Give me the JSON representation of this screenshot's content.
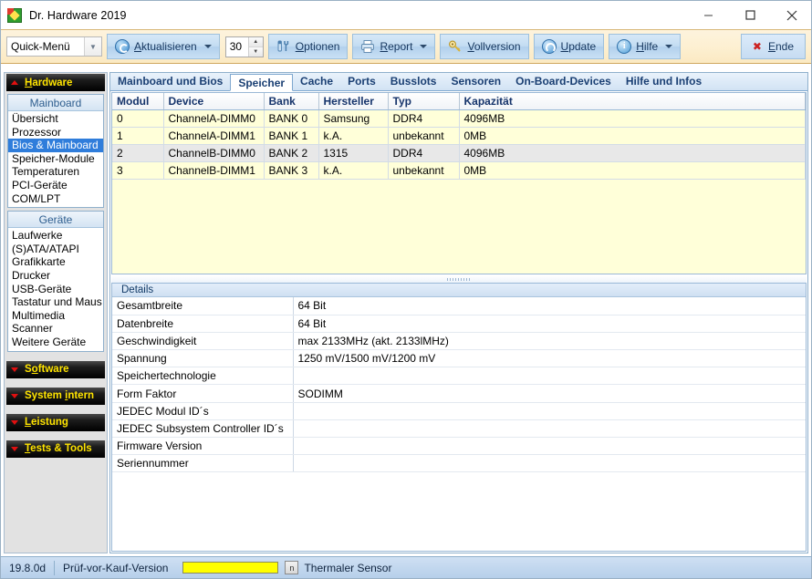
{
  "window": {
    "title": "Dr. Hardware 2019",
    "app_icon": "diamond-logo-icon",
    "controls": {
      "minimize": "minimize-icon",
      "maximize": "maximize-icon",
      "close": "close-icon"
    }
  },
  "toolbar": {
    "quick_menu": {
      "value": "Quick-Menü",
      "arrow": "chevron-down-icon"
    },
    "refresh": {
      "label": "Aktualisieren",
      "accel": "A",
      "icon": "refresh-icon",
      "has_dropdown": true
    },
    "interval": {
      "value": "30"
    },
    "options": {
      "label": "Optionen",
      "accel": "O",
      "icon": "tools-icon"
    },
    "report": {
      "label": "Report",
      "accel": "R",
      "icon": "printer-icon",
      "has_dropdown": true
    },
    "fullversion": {
      "label": "Vollversion",
      "accel": "V",
      "icon": "key-icon"
    },
    "update": {
      "label": "Update",
      "accel": "U",
      "icon": "update-icon"
    },
    "help": {
      "label": "Hilfe",
      "accel": "H",
      "icon": "info-icon",
      "has_dropdown": true
    },
    "end": {
      "label": "Ende",
      "accel": "E",
      "icon": "red-x-icon"
    }
  },
  "sidebar": {
    "groups": [
      {
        "header": "Hardware",
        "accel": "H",
        "expanded": true,
        "arrow": "triangle-up-icon",
        "panels": [
          {
            "title": "Mainboard",
            "items": [
              {
                "label": "Übersicht",
                "selected": false
              },
              {
                "label": "Prozessor",
                "selected": false
              },
              {
                "label": "Bios & Mainboard",
                "selected": true
              },
              {
                "label": "Speicher-Module",
                "selected": false
              },
              {
                "label": "Temperaturen",
                "selected": false
              },
              {
                "label": "PCI-Geräte",
                "selected": false
              },
              {
                "label": "COM/LPT",
                "selected": false
              }
            ]
          },
          {
            "title": "Geräte",
            "items": [
              {
                "label": "Laufwerke",
                "selected": false
              },
              {
                "label": "(S)ATA/ATAPI",
                "selected": false
              },
              {
                "label": "Grafikkarte",
                "selected": false
              },
              {
                "label": "Drucker",
                "selected": false
              },
              {
                "label": "USB-Geräte",
                "selected": false
              },
              {
                "label": "Tastatur und Maus",
                "selected": false
              },
              {
                "label": "Multimedia",
                "selected": false
              },
              {
                "label": "Scanner",
                "selected": false
              },
              {
                "label": "Weitere Geräte",
                "selected": false
              }
            ]
          }
        ]
      },
      {
        "header": "Software",
        "accel": "o",
        "expanded": false,
        "arrow": "triangle-down-icon",
        "panels": []
      },
      {
        "header": "System intern",
        "accel": "i",
        "expanded": false,
        "arrow": "triangle-down-icon",
        "panels": []
      },
      {
        "header": "Leistung",
        "accel": "L",
        "expanded": false,
        "arrow": "triangle-down-icon",
        "panels": []
      },
      {
        "header": "Tests & Tools",
        "accel": "T",
        "expanded": false,
        "arrow": "triangle-down-icon",
        "panels": []
      }
    ]
  },
  "content": {
    "tabs": [
      {
        "label": "Mainboard und Bios",
        "active": false
      },
      {
        "label": "Speicher",
        "active": true
      },
      {
        "label": "Cache",
        "active": false
      },
      {
        "label": "Ports",
        "active": false
      },
      {
        "label": "Busslots",
        "active": false
      },
      {
        "label": "Sensoren",
        "active": false
      },
      {
        "label": "On-Board-Devices",
        "active": false
      },
      {
        "label": "Hilfe und Infos",
        "active": false
      }
    ],
    "grid": {
      "columns": [
        "Modul",
        "Device",
        "Bank",
        "Hersteller",
        "Typ",
        "Kapazität"
      ],
      "rows": [
        {
          "cells": [
            "0",
            "ChannelA-DIMM0",
            "BANK 0",
            "Samsung",
            "DDR4",
            "4096MB"
          ],
          "selected": false
        },
        {
          "cells": [
            "1",
            "ChannelA-DIMM1",
            "BANK 1",
            "k.A.",
            "unbekannt",
            "0MB"
          ],
          "selected": false
        },
        {
          "cells": [
            "2",
            "ChannelB-DIMM0",
            "BANK 2",
            "1315",
            "DDR4",
            "4096MB"
          ],
          "selected": true
        },
        {
          "cells": [
            "3",
            "ChannelB-DIMM1",
            "BANK 3",
            "k.A.",
            "unbekannt",
            "0MB"
          ],
          "selected": false
        }
      ]
    },
    "splitter": {
      "grip": "splitter-grip-icon"
    },
    "details": {
      "title": "Details",
      "rows": [
        {
          "key": "Gesamtbreite",
          "value": "64 Bit"
        },
        {
          "key": "Datenbreite",
          "value": "64 Bit"
        },
        {
          "key": "Geschwindigkeit",
          "value": "max 2133MHz (akt. 2133lMHz)"
        },
        {
          "key": "Spannung",
          "value": "1250 mV/1500 mV/1200 mV"
        },
        {
          "key": "Speichertechnologie",
          "value": ""
        },
        {
          "key": "Form Faktor",
          "value": "SODIMM"
        },
        {
          "key": "JEDEC Modul ID´s",
          "value": ""
        },
        {
          "key": "JEDEC Subsystem Controller ID´s",
          "value": ""
        },
        {
          "key": "Firmware Version",
          "value": ""
        },
        {
          "key": "Seriennummer",
          "value": ""
        }
      ]
    }
  },
  "statusbar": {
    "version": "19.8.0d",
    "edition": "Prüf-vor-Kauf-Version",
    "progress_color": "#ffff00",
    "sensor_icon": "sensor-icon",
    "sensor_label": "Thermaler Sensor"
  }
}
